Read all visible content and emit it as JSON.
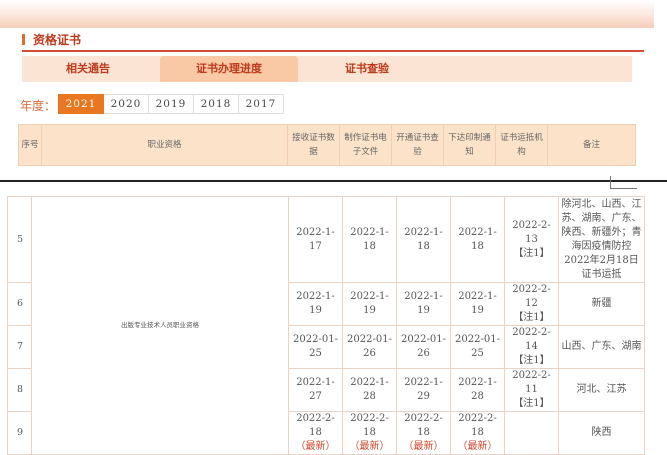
{
  "section": {
    "title": "资格证书"
  },
  "tabs": [
    {
      "label": "相关通告",
      "active": false
    },
    {
      "label": "证书办理进度",
      "active": true
    },
    {
      "label": "证书查验",
      "active": false
    }
  ],
  "year_selector": {
    "label": "年度：",
    "years": [
      "2021",
      "2020",
      "2019",
      "2018",
      "2017"
    ],
    "selected": "2021"
  },
  "table": {
    "headers": {
      "no": "序号",
      "qualification": "职业资格",
      "received": "接收证书数据",
      "made": "制作证书电子文件",
      "check": "开通证书查验",
      "print": "下达印制通知",
      "shipped": "证书运抵机构",
      "remark": "备注"
    },
    "qualification": "出版专业技术人员职业资格",
    "note_label": "【注1】",
    "latest_label": "（最新）",
    "rows": [
      {
        "no": "5",
        "received": "2022-1-17",
        "made": "2022-1-18",
        "check": "2022-1-18",
        "print": "2022-1-18",
        "shipped": "2022-2-13",
        "remark": "除河北、山西、江苏、湖南、广东、陕西、新疆外；青海因疫情防控2022年2月18日证书运抵"
      },
      {
        "no": "6",
        "received": "2022-1-19",
        "made": "2022-1-19",
        "check": "2022-1-19",
        "print": "2022-1-19",
        "shipped": "2022-2-12",
        "remark": "新疆"
      },
      {
        "no": "7",
        "received": "2022-01-25",
        "made": "2022-01-26",
        "check": "2022-01-26",
        "print": "2022-01-25",
        "shipped": "2022-2-14",
        "remark": "山西、广东、湖南"
      },
      {
        "no": "8",
        "received": "2022-1-27",
        "made": "2022-1-28",
        "check": "2022-1-29",
        "print": "2022-1-28",
        "shipped": "2022-2-11",
        "remark": "河北、江苏"
      },
      {
        "no": "9",
        "received": "2022-2-18",
        "made": "2022-2-18",
        "check": "2022-2-18",
        "print": "2022-2-18",
        "shipped": "",
        "remark": "陕西"
      }
    ]
  }
}
